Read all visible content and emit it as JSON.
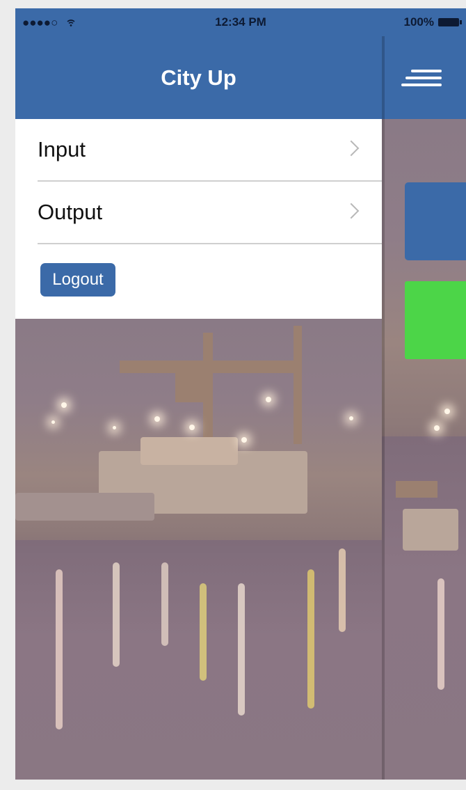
{
  "status_bar": {
    "signal": "●●●●○",
    "time": "12:34 PM",
    "battery": "100%"
  },
  "menu": {
    "title": "City Up",
    "items": [
      {
        "label": "Input"
      },
      {
        "label": "Output"
      }
    ],
    "logout_label": "Logout"
  },
  "icons": {
    "wifi": "wifi-icon",
    "battery": "battery-icon",
    "chevron": "chevron-right-icon",
    "menu": "hamburger-icon"
  },
  "colors": {
    "brand_blue": "#3b6aa8",
    "accent_green": "#4cd548"
  }
}
